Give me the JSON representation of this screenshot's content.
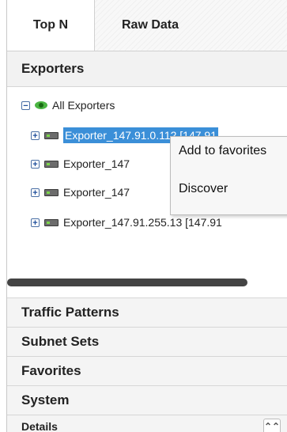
{
  "tabs": [
    {
      "label": "Top N",
      "active": true
    },
    {
      "label": "Raw Data",
      "active": false
    }
  ],
  "exporters_header": "Exporters",
  "tree": {
    "root": {
      "label": "All Exporters",
      "expander": "−",
      "icon": "eye-icon"
    },
    "items": [
      {
        "label": "Exporter_147.91.0.112 [147.91",
        "expander": "+",
        "icon": "device-icon",
        "selected": true
      },
      {
        "label": "Exporter_147",
        "expander": "+",
        "icon": "device-icon",
        "selected": false
      },
      {
        "label": "Exporter_147",
        "expander": "+",
        "icon": "device-icon",
        "selected": false
      },
      {
        "label": "Exporter_147.91.255.13 [147.91",
        "expander": "+",
        "icon": "device-icon",
        "selected": false
      }
    ]
  },
  "context_menu": {
    "items": [
      "Add to favorites",
      "Discover"
    ]
  },
  "accordion": [
    "Traffic Patterns",
    "Subnet Sets",
    "Favorites",
    "System"
  ],
  "details": {
    "label": "Details",
    "collapse_glyph": "⌃⌃"
  },
  "colors": {
    "selection": "#3b8fd8",
    "eye_icon": "#4bb543"
  }
}
